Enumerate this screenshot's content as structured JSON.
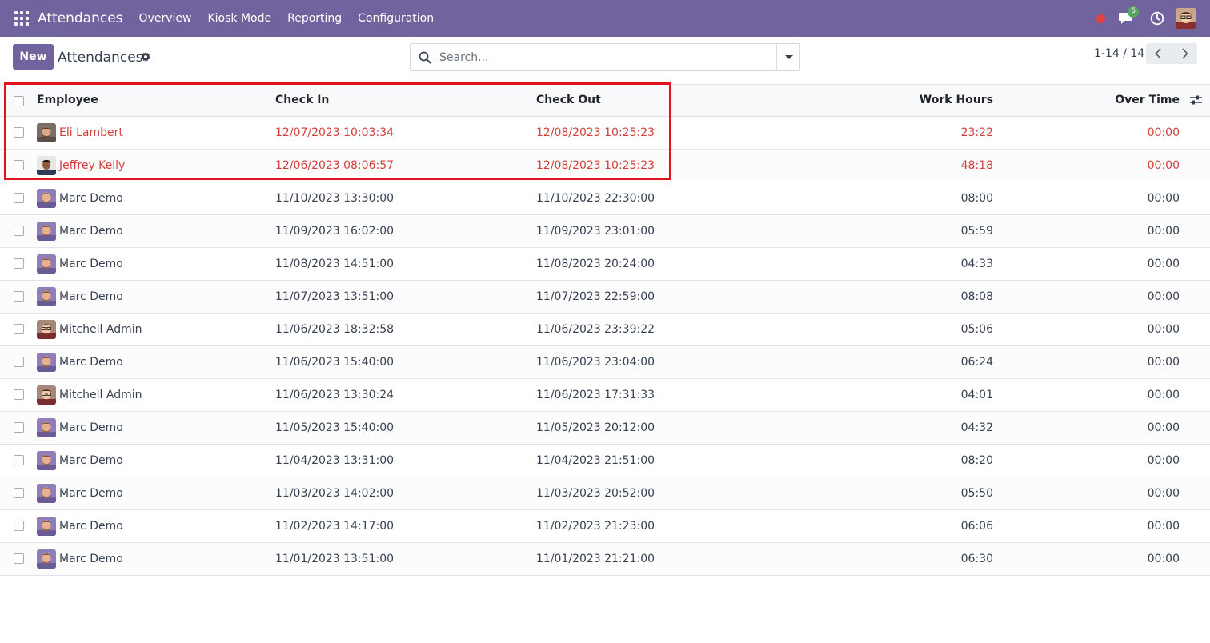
{
  "navbar": {
    "app_name": "Attendances",
    "menu": [
      "Overview",
      "Kiosk Mode",
      "Reporting",
      "Configuration"
    ],
    "chat_count": "6",
    "colors": {
      "bar": "#71639e",
      "record_dot": "#e64040",
      "badge": "#5aa463"
    }
  },
  "control": {
    "new_label": "New",
    "title": "Attendances",
    "search_placeholder": "Search...",
    "pager": "1-14 / 14"
  },
  "table": {
    "columns": [
      "Employee",
      "Check In",
      "Check Out",
      "Work Hours",
      "Over Time"
    ],
    "rows": [
      {
        "employee": "Eli Lambert",
        "avatar": "eli-lambert-photo",
        "check_in": "12/07/2023 10:03:34",
        "check_out": "12/08/2023 10:25:23",
        "work_hours": "23:22",
        "over_time": "00:00",
        "highlight": true
      },
      {
        "employee": "Jeffrey Kelly",
        "avatar": "jeffrey-kelly-photo",
        "check_in": "12/06/2023 08:06:57",
        "check_out": "12/08/2023 10:25:23",
        "work_hours": "48:18",
        "over_time": "00:00",
        "highlight": true
      },
      {
        "employee": "Marc Demo",
        "avatar": "marc-demo-photo",
        "check_in": "11/10/2023 13:30:00",
        "check_out": "11/10/2023 22:30:00",
        "work_hours": "08:00",
        "over_time": "00:00",
        "highlight": false
      },
      {
        "employee": "Marc Demo",
        "avatar": "marc-demo-photo",
        "check_in": "11/09/2023 16:02:00",
        "check_out": "11/09/2023 23:01:00",
        "work_hours": "05:59",
        "over_time": "00:00",
        "highlight": false
      },
      {
        "employee": "Marc Demo",
        "avatar": "marc-demo-photo",
        "check_in": "11/08/2023 14:51:00",
        "check_out": "11/08/2023 20:24:00",
        "work_hours": "04:33",
        "over_time": "00:00",
        "highlight": false
      },
      {
        "employee": "Marc Demo",
        "avatar": "marc-demo-photo",
        "check_in": "11/07/2023 13:51:00",
        "check_out": "11/07/2023 22:59:00",
        "work_hours": "08:08",
        "over_time": "00:00",
        "highlight": false
      },
      {
        "employee": "Mitchell Admin",
        "avatar": "mitchell-admin-photo",
        "check_in": "11/06/2023 18:32:58",
        "check_out": "11/06/2023 23:39:22",
        "work_hours": "05:06",
        "over_time": "00:00",
        "highlight": false
      },
      {
        "employee": "Marc Demo",
        "avatar": "marc-demo-photo",
        "check_in": "11/06/2023 15:40:00",
        "check_out": "11/06/2023 23:04:00",
        "work_hours": "06:24",
        "over_time": "00:00",
        "highlight": false
      },
      {
        "employee": "Mitchell Admin",
        "avatar": "mitchell-admin-photo",
        "check_in": "11/06/2023 13:30:24",
        "check_out": "11/06/2023 17:31:33",
        "work_hours": "04:01",
        "over_time": "00:00",
        "highlight": false
      },
      {
        "employee": "Marc Demo",
        "avatar": "marc-demo-photo",
        "check_in": "11/05/2023 15:40:00",
        "check_out": "11/05/2023 20:12:00",
        "work_hours": "04:32",
        "over_time": "00:00",
        "highlight": false
      },
      {
        "employee": "Marc Demo",
        "avatar": "marc-demo-photo",
        "check_in": "11/04/2023 13:31:00",
        "check_out": "11/04/2023 21:51:00",
        "work_hours": "08:20",
        "over_time": "00:00",
        "highlight": false
      },
      {
        "employee": "Marc Demo",
        "avatar": "marc-demo-photo",
        "check_in": "11/03/2023 14:02:00",
        "check_out": "11/03/2023 20:52:00",
        "work_hours": "05:50",
        "over_time": "00:00",
        "highlight": false
      },
      {
        "employee": "Marc Demo",
        "avatar": "marc-demo-photo",
        "check_in": "11/02/2023 14:17:00",
        "check_out": "11/02/2023 21:23:00",
        "work_hours": "06:06",
        "over_time": "00:00",
        "highlight": false
      },
      {
        "employee": "Marc Demo",
        "avatar": "marc-demo-photo",
        "check_in": "11/01/2023 13:51:00",
        "check_out": "11/01/2023 21:21:00",
        "work_hours": "06:30",
        "over_time": "00:00",
        "highlight": false
      }
    ],
    "colors": {
      "highlight_text": "#d23f3a",
      "highlight_box": "#e3131c"
    }
  }
}
